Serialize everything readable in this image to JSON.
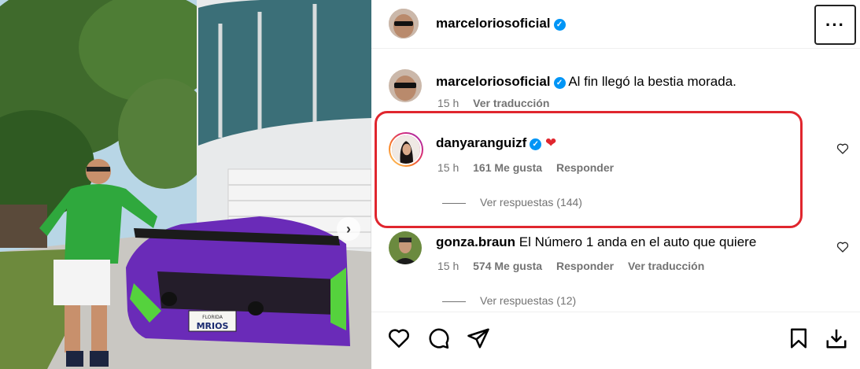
{
  "post": {
    "author": "marceloriosoficial",
    "verified": "✓",
    "more_label": "···"
  },
  "comments": [
    {
      "username": "marceloriosoficial",
      "text": "Al fin llegó la bestia morada.",
      "time": "15 h",
      "translate": "Ver traducción"
    },
    {
      "username": "danyaranguizf",
      "text": "❤",
      "time": "15 h",
      "likes": "161 Me gusta",
      "reply": "Responder",
      "view_replies": "Ver respuestas (144)"
    },
    {
      "username": "gonza.braun",
      "text": "El Número 1 anda en el auto que quiere",
      "time": "15 h",
      "likes": "574 Me gusta",
      "reply": "Responder",
      "translate": "Ver traducción",
      "view_replies": "Ver respuestas (12)"
    }
  ],
  "photo": {
    "plate_state": "FLORIDA",
    "plate_text": "MRIOS",
    "next_icon": "chevron-right-icon"
  },
  "actions": [
    "heart-icon",
    "comment-icon",
    "share-icon",
    "save-icon",
    "download-icon"
  ],
  "colors": {
    "verified": "#0095f6",
    "highlight": "#e0262e",
    "meta": "#737373"
  }
}
